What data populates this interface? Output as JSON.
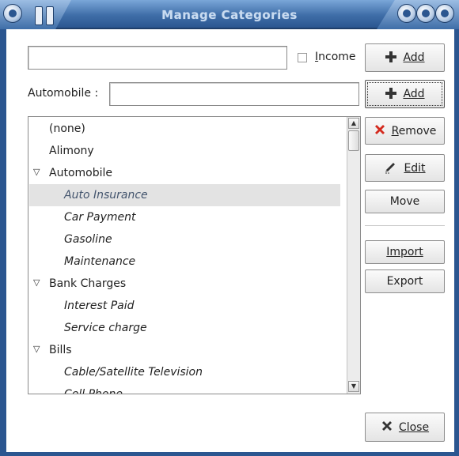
{
  "window": {
    "title": "Manage Categories"
  },
  "form": {
    "category_value": "",
    "income_label": "Income",
    "income_checked": false,
    "parent_label": "Automobile :",
    "sub_value": ""
  },
  "buttons": {
    "add1": "Add",
    "add2": "Add",
    "remove": "Remove",
    "edit": "Edit",
    "move": "Move",
    "import": "Import",
    "export": "Export",
    "close": "Close"
  },
  "list": {
    "rows": [
      {
        "label": "(none)",
        "level": 0,
        "expanded": null,
        "selected": false
      },
      {
        "label": "Alimony",
        "level": 0,
        "expanded": null,
        "selected": false
      },
      {
        "label": "Automobile",
        "level": 0,
        "expanded": true,
        "selected": false
      },
      {
        "label": "Auto Insurance",
        "level": 1,
        "expanded": null,
        "selected": true
      },
      {
        "label": "Car Payment",
        "level": 1,
        "expanded": null,
        "selected": false
      },
      {
        "label": "Gasoline",
        "level": 1,
        "expanded": null,
        "selected": false
      },
      {
        "label": "Maintenance",
        "level": 1,
        "expanded": null,
        "selected": false
      },
      {
        "label": "Bank Charges",
        "level": 0,
        "expanded": true,
        "selected": false
      },
      {
        "label": "Interest Paid",
        "level": 1,
        "expanded": null,
        "selected": false
      },
      {
        "label": "Service charge",
        "level": 1,
        "expanded": null,
        "selected": false
      },
      {
        "label": "Bills",
        "level": 0,
        "expanded": true,
        "selected": false
      },
      {
        "label": "Cable/Satellite Television",
        "level": 1,
        "expanded": null,
        "selected": false
      },
      {
        "label": "Cell Phone",
        "level": 1,
        "expanded": null,
        "selected": false
      }
    ]
  },
  "icons": {
    "add": "plus-icon",
    "remove": "red-x-icon",
    "edit": "pencil-icon",
    "close": "x-icon",
    "expander": "triangle-down-icon"
  },
  "colors": {
    "titlebar": "#3f6ea8",
    "selection_bg": "#e3e3e3",
    "remove_icon": "#d42a1e"
  }
}
